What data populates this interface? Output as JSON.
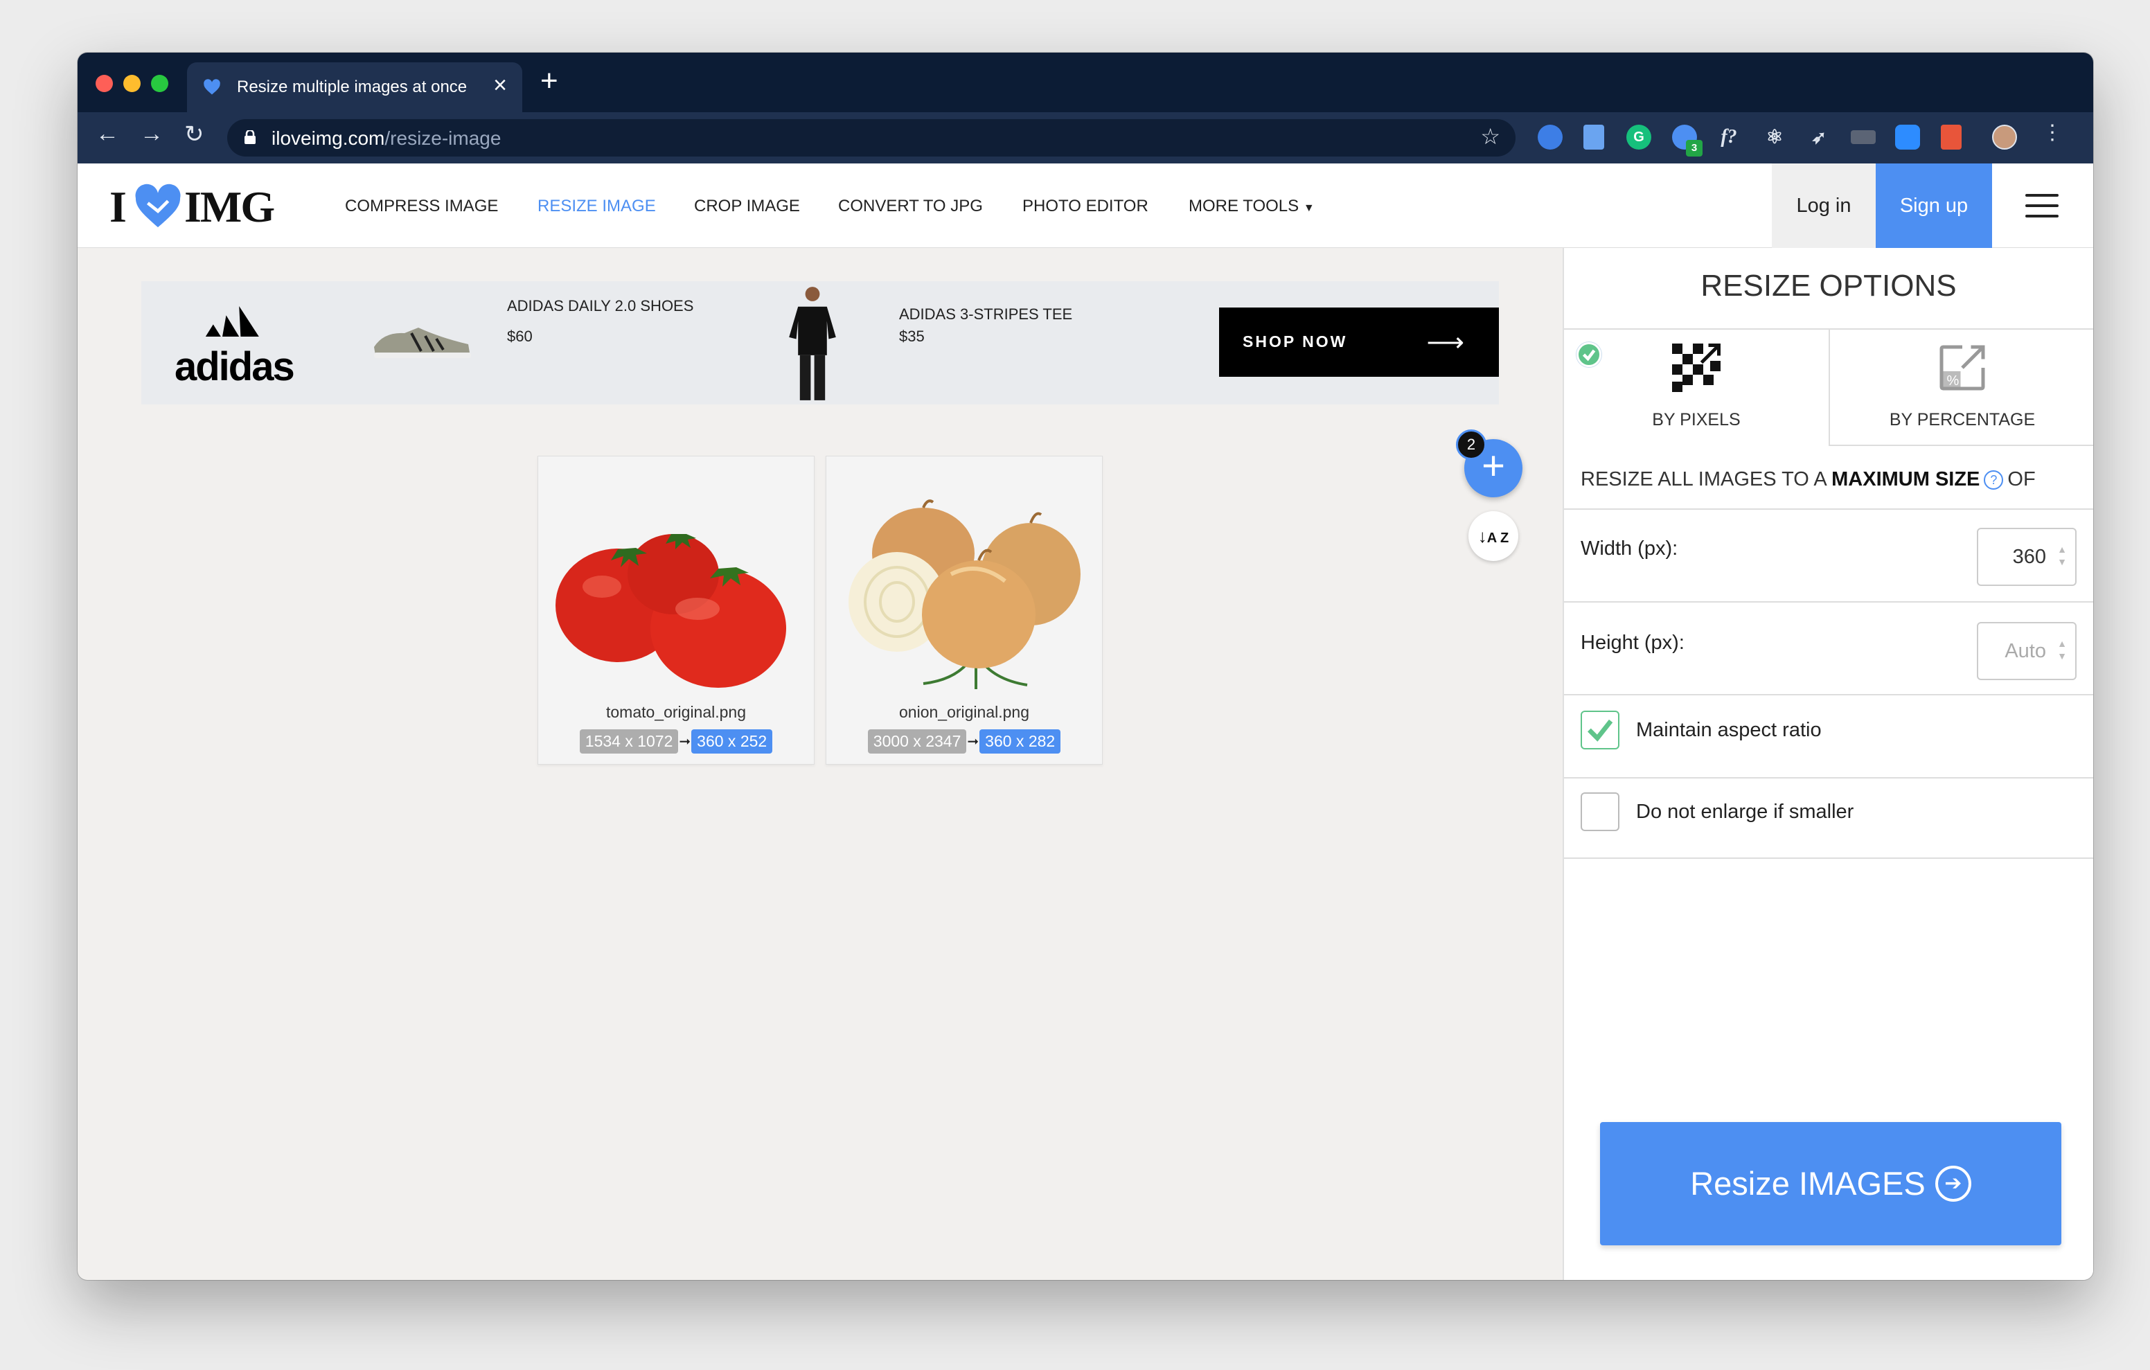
{
  "browser": {
    "tab_title": "Resize multiple images at once",
    "tab_close": "×",
    "new_tab": "+",
    "url_host": "iloveimg.com",
    "url_path": "/resize-image",
    "extension_badge": "3"
  },
  "header": {
    "logo_i": "I",
    "logo_img": "IMG",
    "nav": [
      "COMPRESS IMAGE",
      "RESIZE IMAGE",
      "CROP IMAGE",
      "CONVERT TO JPG",
      "PHOTO EDITOR",
      "MORE TOOLS"
    ],
    "login": "Log in",
    "signup": "Sign up"
  },
  "ad": {
    "brand": "adidas",
    "product1_name": "ADIDAS DAILY 2.0 SHOES",
    "product1_price": "$60",
    "product2_name": "ADIDAS 3-STRIPES TEE",
    "product2_price": "$35",
    "cta": "SHOP NOW"
  },
  "files": [
    {
      "name": "tomato_original.png",
      "original": "1534 x 1072",
      "resized": "360 x 252"
    },
    {
      "name": "onion_original.png",
      "original": "3000 x 2347",
      "resized": "360 x 282"
    }
  ],
  "file_count": "2",
  "sort_label": "A Z",
  "panel": {
    "title": "RESIZE OPTIONS",
    "mode_pixels": "BY PIXELS",
    "mode_percentage": "BY PERCENTAGE",
    "instr_pre": "RESIZE ALL IMAGES TO A",
    "instr_bold": "MAXIMUM SIZE",
    "instr_help": "?",
    "instr_post": "OF",
    "width_label": "Width (px):",
    "width_value": "360",
    "height_label": "Height (px):",
    "height_placeholder": "Auto",
    "aspect_label": "Maintain aspect ratio",
    "aspect_checked": true,
    "noenlarge_label": "Do not enlarge if smaller",
    "noenlarge_checked": false,
    "submit": "Resize IMAGES"
  },
  "colors": {
    "accent": "#4d8ff2",
    "success": "#5fc48a",
    "chrome_dark": "#0c1c35"
  }
}
